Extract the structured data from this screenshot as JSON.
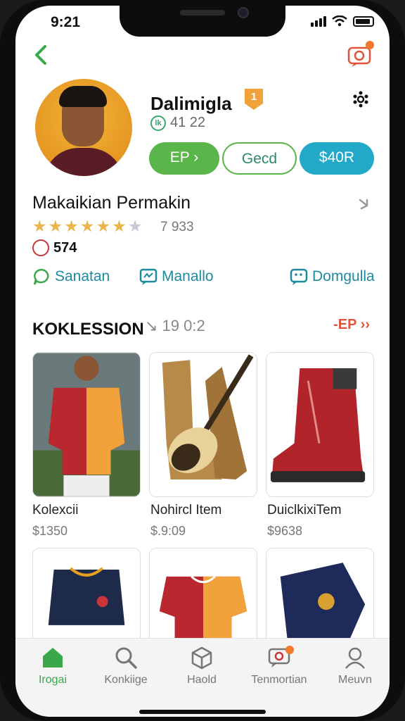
{
  "status_bar": {
    "time": "9:21"
  },
  "profile": {
    "name": "Dalimigla",
    "badge": "1",
    "stat": "41 22",
    "stat_icon_glyph": "lk",
    "buttons": [
      "EP ›",
      "Gecd",
      "$40R"
    ]
  },
  "section": {
    "title": "Makaikian Permakin",
    "rating_stars": 4.5,
    "rating_count": "7 933",
    "followers": "574"
  },
  "actions": [
    {
      "label": "Sanatan",
      "icon": "chat-bubble-icon"
    },
    {
      "label": "Manallo",
      "icon": "message-box-icon"
    },
    {
      "label": "Domgulla",
      "icon": "comment-icon"
    }
  ],
  "collection": {
    "title": "KOKLESSION",
    "meta": "↘ 19 0:2",
    "more_label": "-EP ››",
    "items": [
      {
        "name": "Kolexcii",
        "price": "$1350"
      },
      {
        "name": "Nohircl Item",
        "price": "$.9:09"
      },
      {
        "name": "DuiclkixiTem",
        "price": "$9638"
      }
    ]
  },
  "tabbar": {
    "items": [
      {
        "label": "Irogai",
        "icon": "home-icon",
        "active": true
      },
      {
        "label": "Konkiige",
        "icon": "search-icon",
        "active": false
      },
      {
        "label": "Haold",
        "icon": "box-icon",
        "active": false
      },
      {
        "label": "Tenmortian",
        "icon": "notification-icon",
        "active": false
      },
      {
        "label": "Meuvn",
        "icon": "profile-icon",
        "active": false
      }
    ]
  },
  "colors": {
    "accent_green": "#5ab54a",
    "accent_teal": "#22a9c8",
    "link_teal": "#1e8aa0",
    "alert_orange": "#f07a2a",
    "more_red": "#e0553a"
  }
}
